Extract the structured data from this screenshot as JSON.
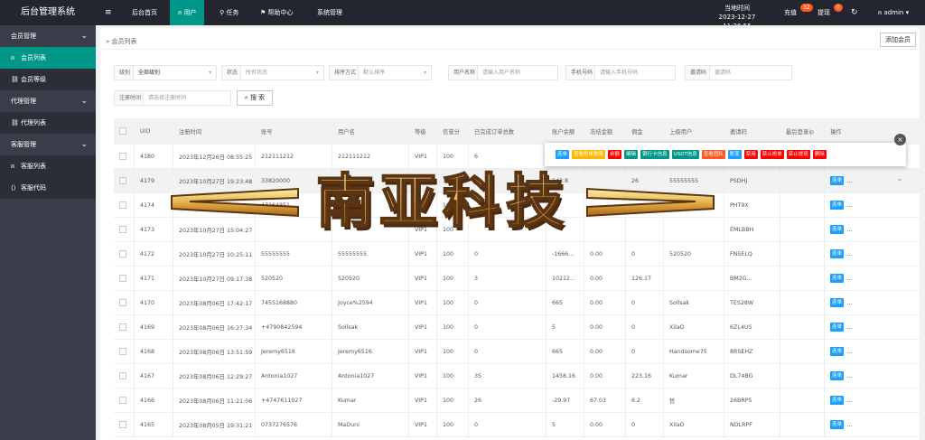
{
  "header": {
    "logo": "后台管理系统",
    "menu_toggle": "≡",
    "nav": [
      {
        "label": "后台首页",
        "icon": ""
      },
      {
        "label": "用户",
        "icon": "user-icon"
      },
      {
        "label": "任务",
        "icon": "walk-icon"
      },
      {
        "label": "帮助中心",
        "icon": "flag-icon"
      },
      {
        "label": "系统管理",
        "icon": ""
      }
    ],
    "time_label": "当地时间",
    "time_value": "2023-12-27 11:26:55",
    "recharge_label": "充值",
    "recharge_badge": "32",
    "withdraw_label": "提现",
    "withdraw_badge": "0",
    "refresh_icon": "↻",
    "user_name": "admin"
  },
  "sidebar": {
    "groups": [
      {
        "label": "会员管理",
        "items": [
          {
            "label": "会员列表",
            "icon": "user-icon",
            "active": true
          },
          {
            "label": "会员等级",
            "icon": "link-icon",
            "active": false
          }
        ]
      },
      {
        "label": "代理管理",
        "items": [
          {
            "label": "代理列表",
            "icon": "link-icon",
            "active": false
          }
        ]
      },
      {
        "label": "客服管理",
        "items": [
          {
            "label": "客服列表",
            "icon": "users-icon",
            "active": false
          },
          {
            "label": "客服代码",
            "icon": "code-icon",
            "active": false
          }
        ]
      }
    ]
  },
  "page": {
    "breadcrumb": "会员列表",
    "add_button": "添加会员"
  },
  "filters": {
    "level": {
      "label": "级别",
      "value": "全部级别"
    },
    "status": {
      "label": "状态",
      "placeholder": "所有状态"
    },
    "sort": {
      "label": "排序方式",
      "placeholder": "默认排序"
    },
    "username": {
      "label": "用户名称",
      "placeholder": "请输入用户名称"
    },
    "phone": {
      "label": "手机号码",
      "placeholder": "请输入手机号码"
    },
    "invite": {
      "label": "邀请码",
      "placeholder": "邀请码"
    },
    "reg_time": {
      "label": "注册时间",
      "placeholder": "请选择注册时间"
    },
    "search_button": "搜 索"
  },
  "table": {
    "columns": [
      "UID",
      "注册时间",
      "账号",
      "用户名",
      "等级",
      "信誉分",
      "已完成订单总数",
      "账户余额",
      "冻结金额",
      "佣金",
      "上级用户",
      "邀请码",
      "最后登录ip",
      "操作"
    ],
    "rows": [
      [
        "4180",
        "2023年12月26日 08:55:25",
        "212111212",
        "212111212",
        "VIP1",
        "100",
        "6",
        "",
        "",
        "",
        "",
        "",
        "",
        ""
      ],
      [
        "4179",
        "2023年10月27日 19:23:48",
        "33820000",
        "",
        "VIP1",
        "100",
        "",
        "143.8",
        "",
        "26",
        "55555555",
        "PSDHJ",
        "",
        ""
      ],
      [
        "4174",
        "2023年10月27日 16:41:27",
        "47264851",
        "",
        "VIP1",
        "100",
        "",
        "",
        "",
        "",
        "",
        "PHT9X",
        "",
        ""
      ],
      [
        "4173",
        "2023年10月27日 15:04:27",
        "",
        "",
        "VIP1",
        "100",
        "",
        "",
        "",
        "",
        "",
        "EMLBBH",
        "",
        ""
      ],
      [
        "4172",
        "2023年10月27日 10:25:11",
        "55555555",
        "55555555",
        "VIP1",
        "100",
        "0",
        "-1666...",
        "0.00",
        "0",
        "520520",
        "FN5ELQ",
        "",
        ""
      ],
      [
        "4171",
        "2023年10月27日 09:17:38",
        "520520",
        "520520",
        "VIP1",
        "100",
        "3",
        "10212...",
        "0.00",
        "126.17",
        "",
        "BM2G...",
        "",
        ""
      ],
      [
        "4170",
        "2023年08月06日 17:42:17",
        "7455168880",
        "Joyce%2594",
        "VIP1",
        "100",
        "0",
        "665",
        "0.00",
        "0",
        "Sollsak",
        "TES28W",
        "",
        ""
      ],
      [
        "4169",
        "2023年08月06日 16:27:34",
        "+4790842594",
        "Sollsak",
        "VIP1",
        "100",
        "0",
        "5",
        "0.00",
        "0",
        "XilaO",
        "6ZL4US",
        "",
        ""
      ],
      [
        "4168",
        "2023年08月06日 13:51:59",
        "Jeremy6516",
        "Jeremy6516",
        "VIP1",
        "100",
        "0",
        "665",
        "0.00",
        "0",
        "Handsome75",
        "8RSEHZ",
        "",
        ""
      ],
      [
        "4167",
        "2023年08月06日 12:29:27",
        "Antonia1027",
        "Antonia1027",
        "VIP1",
        "100",
        "35",
        "1458.16",
        "0.00",
        "223.16",
        "Kumar",
        "DL74BG",
        "",
        ""
      ],
      [
        "4166",
        "2023年08月06日 11:21:06",
        "+4747611027",
        "Kumar",
        "VIP1",
        "100",
        "26",
        "-29.97",
        "67.03",
        "6.2",
        "哲",
        "26BRP5",
        "",
        ""
      ],
      [
        "4165",
        "2023年08月05日 19:31:21",
        "0737276576",
        "MaDuni",
        "VIP1",
        "100",
        "0",
        "5",
        "0.00",
        "0",
        "XilaO",
        "NDLRPF",
        "",
        ""
      ]
    ],
    "row_action_label": "连单",
    "row_more": "..."
  },
  "popup_actions": [
    {
      "label": "连单",
      "color": "#1e9fff"
    },
    {
      "label": "查看抢单数量",
      "color": "#ffb800"
    },
    {
      "label": "余额",
      "color": "#ff0000"
    },
    {
      "label": "编辑",
      "color": "#009688"
    },
    {
      "label": "银行卡信息",
      "color": "#009688"
    },
    {
      "label": "USDT信息",
      "color": "#009688"
    },
    {
      "label": "查看团队",
      "color": "#ff5722"
    },
    {
      "label": "账变",
      "color": "#1e9fff"
    },
    {
      "label": "禁用",
      "color": "#ff0000"
    },
    {
      "label": "禁止抢单",
      "color": "#ff0000"
    },
    {
      "label": "禁止提现",
      "color": "#ff0000"
    },
    {
      "label": "删除",
      "color": "#ff0000"
    }
  ],
  "watermark": "南亚科技",
  "colors": {
    "accent": "#009688",
    "topbar": "#23262e",
    "sidebar": "#393d49",
    "primary": "#1e9fff",
    "danger": "#ff0000"
  }
}
